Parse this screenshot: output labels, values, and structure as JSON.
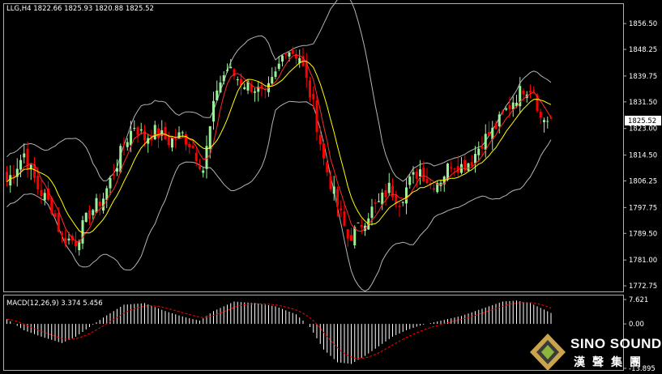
{
  "header": {
    "symbol_info": "LLG,H4  1822.66 1825.93 1820.88 1825.52",
    "macd_info": "MACD(12,26,9) 3.374 5.456"
  },
  "colors": {
    "bull": "#9cf09c",
    "bear": "#ff0000",
    "ma_fast": "#ff2a2a",
    "ma_slow": "#ffff00",
    "bands": "#b4b4b4",
    "macd_hist": "#ffffff",
    "macd_signal": "#ff0000",
    "grid_frame": "#b0b0b0"
  },
  "logo": {
    "brand_en": "SINO SOUND",
    "brand_cn": "漢聲集團"
  },
  "chart_data": [
    {
      "type": "candlestick",
      "panel": "price",
      "ylim": [
        1770.7,
        1863.0
      ],
      "price_axis_ticks": [
        "1856.50",
        "1848.25",
        "1839.75",
        "1831.50",
        "1823.00",
        "1814.50",
        "1806.25",
        "1797.75",
        "1789.50",
        "1781.00",
        "1772.75"
      ],
      "current_price_label": "1825.52",
      "series": [
        {
          "name": "bollinger_bands",
          "style": "gray lines"
        },
        {
          "name": "ma_fast",
          "style": "red line"
        },
        {
          "name": "ma_slow",
          "style": "yellow line"
        }
      ],
      "close_path": [
        [
          0,
          1806
        ],
        [
          5,
          1815
        ],
        [
          9,
          1804
        ],
        [
          13,
          1798
        ],
        [
          16,
          1788
        ],
        [
          20,
          1787
        ],
        [
          24,
          1796
        ],
        [
          28,
          1801
        ],
        [
          31,
          1809
        ],
        [
          34,
          1818
        ],
        [
          37,
          1824
        ],
        [
          40,
          1820
        ],
        [
          43,
          1822
        ],
        [
          47,
          1819
        ],
        [
          51,
          1821
        ],
        [
          54,
          1817
        ],
        [
          57,
          1810
        ],
        [
          61,
          1836
        ],
        [
          64,
          1842
        ],
        [
          68,
          1838
        ],
        [
          72,
          1836
        ],
        [
          75,
          1833
        ],
        [
          78,
          1840
        ],
        [
          81,
          1849
        ],
        [
          85,
          1846
        ],
        [
          89,
          1830
        ],
        [
          92,
          1813
        ],
        [
          95,
          1802
        ],
        [
          97,
          1795
        ],
        [
          99,
          1788
        ],
        [
          102,
          1791
        ],
        [
          105,
          1796
        ],
        [
          108,
          1799
        ],
        [
          111,
          1804
        ],
        [
          114,
          1800
        ],
        [
          117,
          1806
        ],
        [
          120,
          1810
        ],
        [
          123,
          1805
        ],
        [
          126,
          1807
        ],
        [
          129,
          1812
        ],
        [
          132,
          1811
        ],
        [
          135,
          1813
        ],
        [
          138,
          1819
        ],
        [
          141,
          1822
        ],
        [
          144,
          1827
        ],
        [
          147,
          1832
        ],
        [
          150,
          1836
        ],
        [
          153,
          1836
        ],
        [
          155,
          1826
        ],
        [
          158,
          1826
        ]
      ],
      "ohlc_ranges": [
        [
          0,
          9,
          1804,
          1818
        ],
        [
          10,
          18,
          1783,
          1805
        ],
        [
          19,
          31,
          1786,
          1820
        ],
        [
          32,
          40,
          1812,
          1828
        ],
        [
          41,
          55,
          1814,
          1827
        ],
        [
          56,
          57,
          1809,
          1817
        ],
        [
          58,
          66,
          1832,
          1850
        ],
        [
          67,
          77,
          1830,
          1846
        ],
        [
          78,
          85,
          1843,
          1852
        ],
        [
          86,
          92,
          1810,
          1845
        ],
        [
          93,
          99,
          1785,
          1812
        ],
        [
          100,
          110,
          1790,
          1805
        ],
        [
          111,
          125,
          1797,
          1813
        ],
        [
          126,
          137,
          1805,
          1818
        ],
        [
          138,
          153,
          1815,
          1840
        ],
        [
          154,
          158,
          1820,
          1833
        ]
      ]
    },
    {
      "type": "bar",
      "panel": "macd",
      "name": "MACD(12,26,9)",
      "ylim": [
        -13.895,
        7.621
      ],
      "axis_ticks": [
        "7.621",
        "0.00",
        "-13.895"
      ],
      "macd": 3.374,
      "signal": 5.456,
      "histogram_path": [
        [
          0,
          1.5
        ],
        [
          5,
          -2
        ],
        [
          10,
          -4
        ],
        [
          16,
          -6
        ],
        [
          20,
          -4
        ],
        [
          24,
          -1
        ],
        [
          28,
          2
        ],
        [
          34,
          6
        ],
        [
          40,
          6.5
        ],
        [
          46,
          4
        ],
        [
          52,
          2
        ],
        [
          56,
          1
        ],
        [
          60,
          4
        ],
        [
          66,
          7
        ],
        [
          72,
          6.5
        ],
        [
          78,
          5.5
        ],
        [
          84,
          3
        ],
        [
          88,
          -1
        ],
        [
          92,
          -8
        ],
        [
          96,
          -12
        ],
        [
          100,
          -12.5
        ],
        [
          104,
          -10
        ],
        [
          108,
          -7
        ],
        [
          112,
          -4
        ],
        [
          116,
          -2
        ],
        [
          120,
          -0.5
        ],
        [
          124,
          0.5
        ],
        [
          128,
          1.5
        ],
        [
          132,
          2.5
        ],
        [
          136,
          4
        ],
        [
          140,
          5.5
        ],
        [
          144,
          7
        ],
        [
          148,
          7.3
        ],
        [
          152,
          6.5
        ],
        [
          156,
          4.5
        ],
        [
          158,
          3.4
        ]
      ]
    }
  ]
}
